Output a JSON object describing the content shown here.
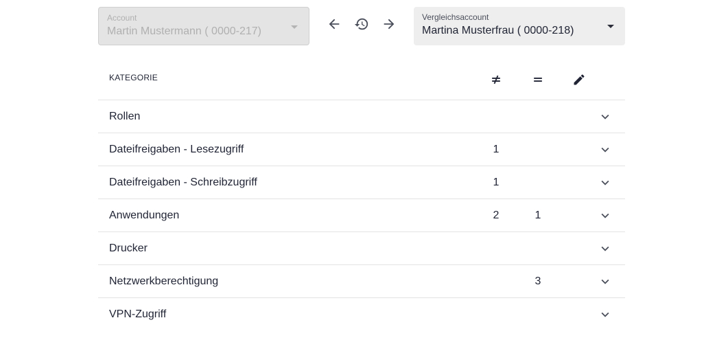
{
  "account_select": {
    "label": "Account",
    "value": "Martin Mustermann ( 0000-217)",
    "disabled": true
  },
  "compare_select": {
    "label": "Vergleichsaccount",
    "value": "Martina Musterfrau ( 0000-218)"
  },
  "nav": {
    "back_icon": "arrow-left-icon",
    "history_icon": "history-icon",
    "forward_icon": "arrow-right-icon"
  },
  "table": {
    "header": {
      "category": "KATEGORIE",
      "diff_icon": "not-equal-icon",
      "same_icon": "equal-icon",
      "edit_icon": "pencil-icon"
    },
    "rows": [
      {
        "category": "Rollen",
        "diff": "",
        "same": ""
      },
      {
        "category": "Dateifreigaben - Lesezugriff",
        "diff": "1",
        "same": ""
      },
      {
        "category": "Dateifreigaben - Schreibzugriff",
        "diff": "1",
        "same": ""
      },
      {
        "category": "Anwendungen",
        "diff": "2",
        "same": "1"
      },
      {
        "category": "Drucker",
        "diff": "",
        "same": ""
      },
      {
        "category": "Netzwerkberechtigung",
        "diff": "",
        "same": "3"
      },
      {
        "category": "VPN-Zugriff",
        "diff": "",
        "same": ""
      }
    ]
  },
  "colors": {
    "text": "#1f2333",
    "disabled_bg": "#e4e4e4",
    "field_bg": "#eeeeee",
    "divider": "#e3e3e3"
  }
}
